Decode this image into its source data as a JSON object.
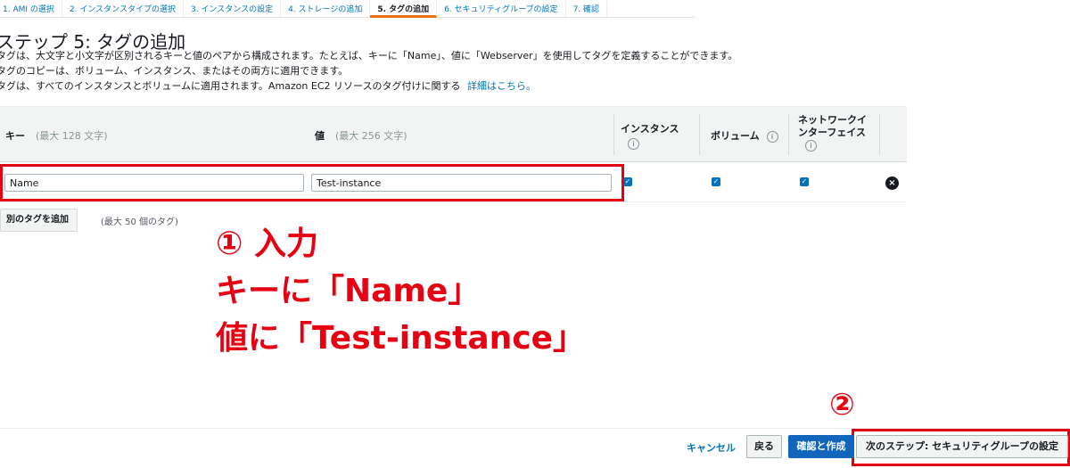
{
  "wizard": {
    "steps": [
      "1. AMI の選択",
      "2. インスタンスタイプの選択",
      "3. インスタンスの設定",
      "4. ストレージの追加",
      "5. タグの追加",
      "6. セキュリティグループの設定",
      "7. 確認"
    ],
    "active_index": 4
  },
  "page": {
    "title": "ステップ 5: タグの追加",
    "desc1": "タグは、大文字と小文字が区別されるキーと値のペアから構成されます。たとえば、キーに「Name」、値に「Webserver」を使用してタグを定義することができます。",
    "desc2": "タグのコピーは、ボリューム、インスタンス、またはその両方に適用できます。",
    "desc3": "タグは、すべてのインスタンスとボリュームに適用されます。Amazon EC2 リソースのタグ付けに関する",
    "details_link": "詳細はこちら。"
  },
  "table": {
    "key_header": "キー",
    "key_hint": "(最大 128 文字)",
    "value_header": "値",
    "value_hint": "(最大 256 文字)",
    "instance_header": "インスタンス",
    "volume_header": "ボリューム",
    "eni_header_line1": "ネットワークイ",
    "eni_header_line2": "ンターフェイス",
    "info_glyph": "i",
    "row": {
      "key": "Name",
      "value": "Test-instance",
      "instance_checked": true,
      "volume_checked": true,
      "eni_checked": true
    }
  },
  "add_tag": {
    "button": "別のタグを追加",
    "hint": "(最大 50 個のタグ)"
  },
  "annotation": {
    "line1": "① 入力",
    "line2": "キーに「Name」",
    "line3": "値に「Test-instance」",
    "marker2": "②"
  },
  "footer": {
    "cancel": "キャンセル",
    "back": "戻る",
    "review": "確認と作成",
    "next": "次のステップ: セキュリティグループの設定"
  },
  "colors": {
    "link": "#0073bb",
    "primary": "#1166bb",
    "annotation": "#e60012",
    "active_step": "#ec7211"
  }
}
